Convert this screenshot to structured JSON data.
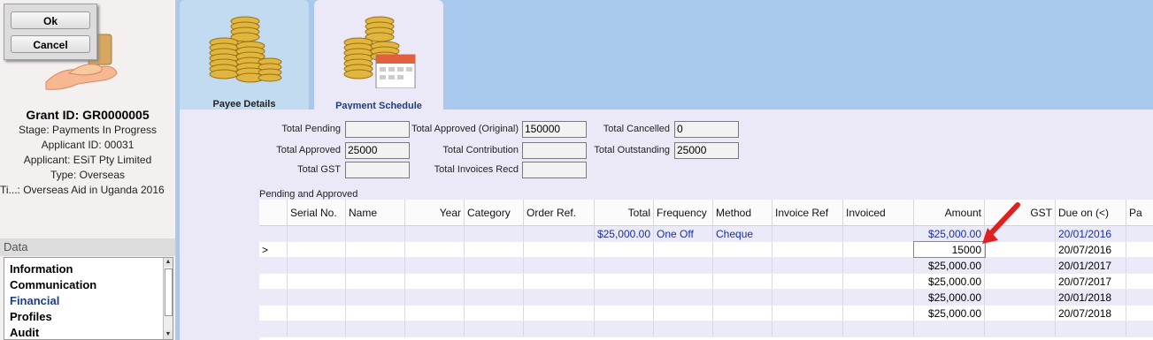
{
  "dialog": {
    "ok_label": "Ok",
    "cancel_label": "Cancel"
  },
  "grant": {
    "id_line": "Grant ID: GR0000005",
    "stage": "Stage: Payments In Progress",
    "applicant_id": "Applicant ID: 00031",
    "applicant": "Applicant: ESiT Pty Limited",
    "type": "Type: Overseas",
    "title": "Ti...: Overseas Aid in Uganda 2016"
  },
  "data_panel": {
    "header": "Data",
    "items": [
      "Information",
      "Communication",
      "Financial",
      "Profiles",
      "Audit"
    ],
    "selected": "Financial"
  },
  "tabs": [
    {
      "label": "Payee Details"
    },
    {
      "label": "Payment Schedule"
    }
  ],
  "totals": {
    "total_pending": {
      "label": "Total Pending",
      "value": ""
    },
    "total_approved": {
      "label": "Total Approved",
      "value": "25000"
    },
    "total_gst": {
      "label": "Total GST",
      "value": ""
    },
    "total_approved_original": {
      "label": "Total Approved (Original)",
      "value": "150000"
    },
    "total_contribution": {
      "label": "Total Contribution",
      "value": ""
    },
    "total_invoices_recd": {
      "label": "Total Invoices Recd",
      "value": ""
    },
    "total_cancelled": {
      "label": "Total Cancelled",
      "value": "0"
    },
    "total_outstanding": {
      "label": "Total Outstanding",
      "value": "25000"
    }
  },
  "grid": {
    "section_title": "Pending and Approved",
    "columns": [
      "Serial No.",
      "Name",
      "Year",
      "Category",
      "Order Ref.",
      "Total",
      "Frequency",
      "Method",
      "Invoice Ref",
      "Invoiced",
      "Amount",
      "GST",
      "Due on (<)",
      "Pa"
    ],
    "rows": [
      {
        "indicator": "",
        "total": "$25,000.00",
        "frequency": "One Off",
        "method": "Cheque",
        "amount": "$25,000.00",
        "due": "20/01/2016"
      },
      {
        "indicator": ">",
        "total": "",
        "frequency": "",
        "method": "",
        "amount": "15000",
        "due": "20/07/2016"
      },
      {
        "indicator": "",
        "total": "",
        "frequency": "",
        "method": "",
        "amount": "$25,000.00",
        "due": "20/01/2017"
      },
      {
        "indicator": "",
        "total": "",
        "frequency": "",
        "method": "",
        "amount": "$25,000.00",
        "due": "20/07/2017"
      },
      {
        "indicator": "",
        "total": "",
        "frequency": "",
        "method": "",
        "amount": "$25,000.00",
        "due": "20/01/2018"
      },
      {
        "indicator": "",
        "total": "",
        "frequency": "",
        "method": "",
        "amount": "$25,000.00",
        "due": "20/07/2018"
      },
      {
        "indicator": "",
        "total": "",
        "frequency": "",
        "method": "",
        "amount": "",
        "due": ""
      }
    ]
  },
  "colors": {
    "accent_blue": "#1c2ea8",
    "arrow_red": "#e02020"
  }
}
